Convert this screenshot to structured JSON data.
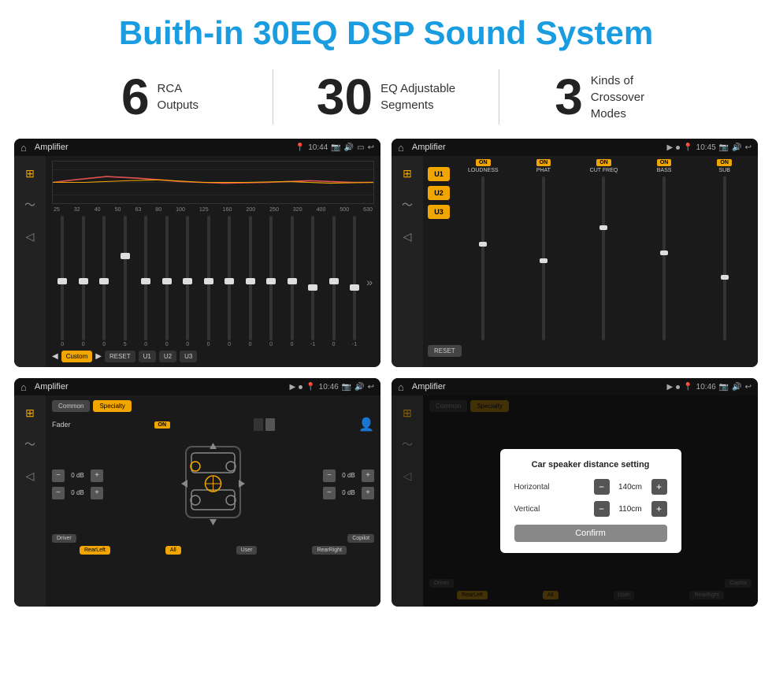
{
  "header": {
    "title": "Buith-in 30EQ DSP Sound System"
  },
  "stats": [
    {
      "number": "6",
      "label": "RCA\nOutputs"
    },
    {
      "number": "30",
      "label": "EQ Adjustable\nSegments"
    },
    {
      "number": "3",
      "label": "Kinds of\nCrossover Modes"
    }
  ],
  "screens": [
    {
      "id": "eq-screen",
      "status_title": "Amplifier",
      "status_time": "10:44",
      "type": "eq"
    },
    {
      "id": "crossover-screen",
      "status_title": "Amplifier",
      "status_time": "10:45",
      "type": "crossover"
    },
    {
      "id": "fader-screen",
      "status_title": "Amplifier",
      "status_time": "10:46",
      "type": "fader"
    },
    {
      "id": "distance-screen",
      "status_title": "Amplifier",
      "status_time": "10:46",
      "type": "distance"
    }
  ],
  "eq": {
    "freq_labels": [
      "25",
      "32",
      "40",
      "50",
      "63",
      "80",
      "100",
      "125",
      "160",
      "200",
      "250",
      "320",
      "400",
      "500",
      "630"
    ],
    "sliders": [
      0,
      0,
      0,
      5,
      0,
      0,
      0,
      0,
      0,
      0,
      0,
      0,
      -1,
      0,
      -1
    ],
    "buttons": [
      "Custom",
      "RESET",
      "U1",
      "U2",
      "U3"
    ]
  },
  "crossover": {
    "u_buttons": [
      "U1",
      "U2",
      "U3"
    ],
    "channels": [
      {
        "name": "LOUDNESS",
        "on": true
      },
      {
        "name": "PHAT",
        "on": true
      },
      {
        "name": "CUT FREQ",
        "on": true
      },
      {
        "name": "BASS",
        "on": true
      },
      {
        "name": "SUB",
        "on": true
      }
    ],
    "reset": "RESET"
  },
  "fader": {
    "tabs": [
      "Common",
      "Specialty"
    ],
    "fader_label": "Fader",
    "on_label": "ON",
    "levels": [
      "0 dB",
      "0 dB",
      "0 dB",
      "0 dB"
    ],
    "positions": [
      "Driver",
      "Copilot",
      "RearLeft",
      "All",
      "User",
      "RearRight"
    ]
  },
  "distance_dialog": {
    "title": "Car speaker distance setting",
    "horizontal_label": "Horizontal",
    "horizontal_value": "140cm",
    "vertical_label": "Vertical",
    "vertical_value": "110cm",
    "confirm_label": "Confirm"
  }
}
